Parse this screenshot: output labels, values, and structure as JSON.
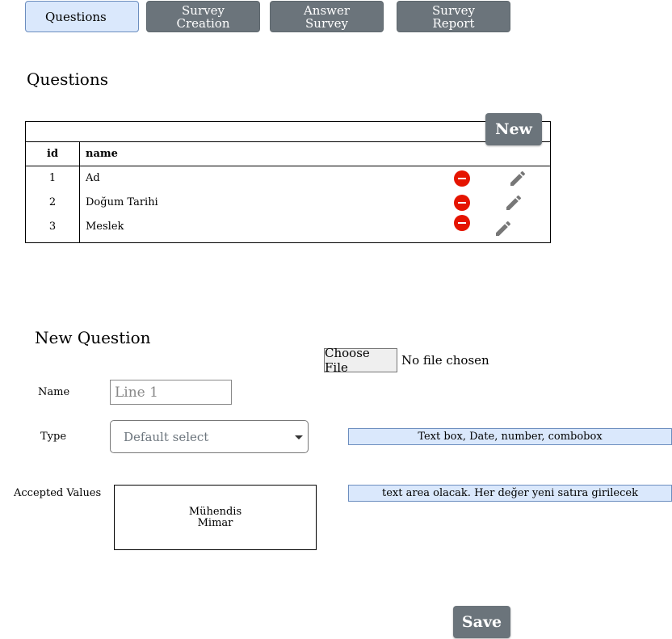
{
  "tabs": [
    {
      "label": "Questions",
      "active": true
    },
    {
      "label": "Survey\nCreation",
      "active": false
    },
    {
      "label": "Answer\nSurvey",
      "active": false
    },
    {
      "label": "Survey\nReport",
      "active": false
    }
  ],
  "questions": {
    "title": "Questions",
    "new_label": "New",
    "columns": {
      "id": "id",
      "name": "name"
    },
    "rows": [
      {
        "id": "1",
        "name": "Ad"
      },
      {
        "id": "2",
        "name": "Doğum Tarihi"
      },
      {
        "id": "3",
        "name": "Meslek"
      }
    ]
  },
  "new_question": {
    "title": "New Question",
    "file": {
      "button": "Choose File",
      "status": "No file chosen"
    },
    "name_label": "Name",
    "name_placeholder": "Line 1",
    "type_label": "Type",
    "type_selected": "Default select",
    "type_note": "Text box, Date, number, combobox",
    "accepted_label": "Accepted Values",
    "accepted_values": [
      "Mühendis",
      "Mimar"
    ],
    "accepted_note": "text area olacak. Her değer yeni satıra girilecek",
    "save_label": "Save"
  },
  "colors": {
    "tab_active_bg": "#dae8fc",
    "tab_inactive_bg": "#6b747b",
    "delete_red": "#e51400",
    "note_bg": "#dae8fc"
  },
  "icons": {
    "delete": "minus-circle-icon",
    "edit": "pencil-icon"
  }
}
